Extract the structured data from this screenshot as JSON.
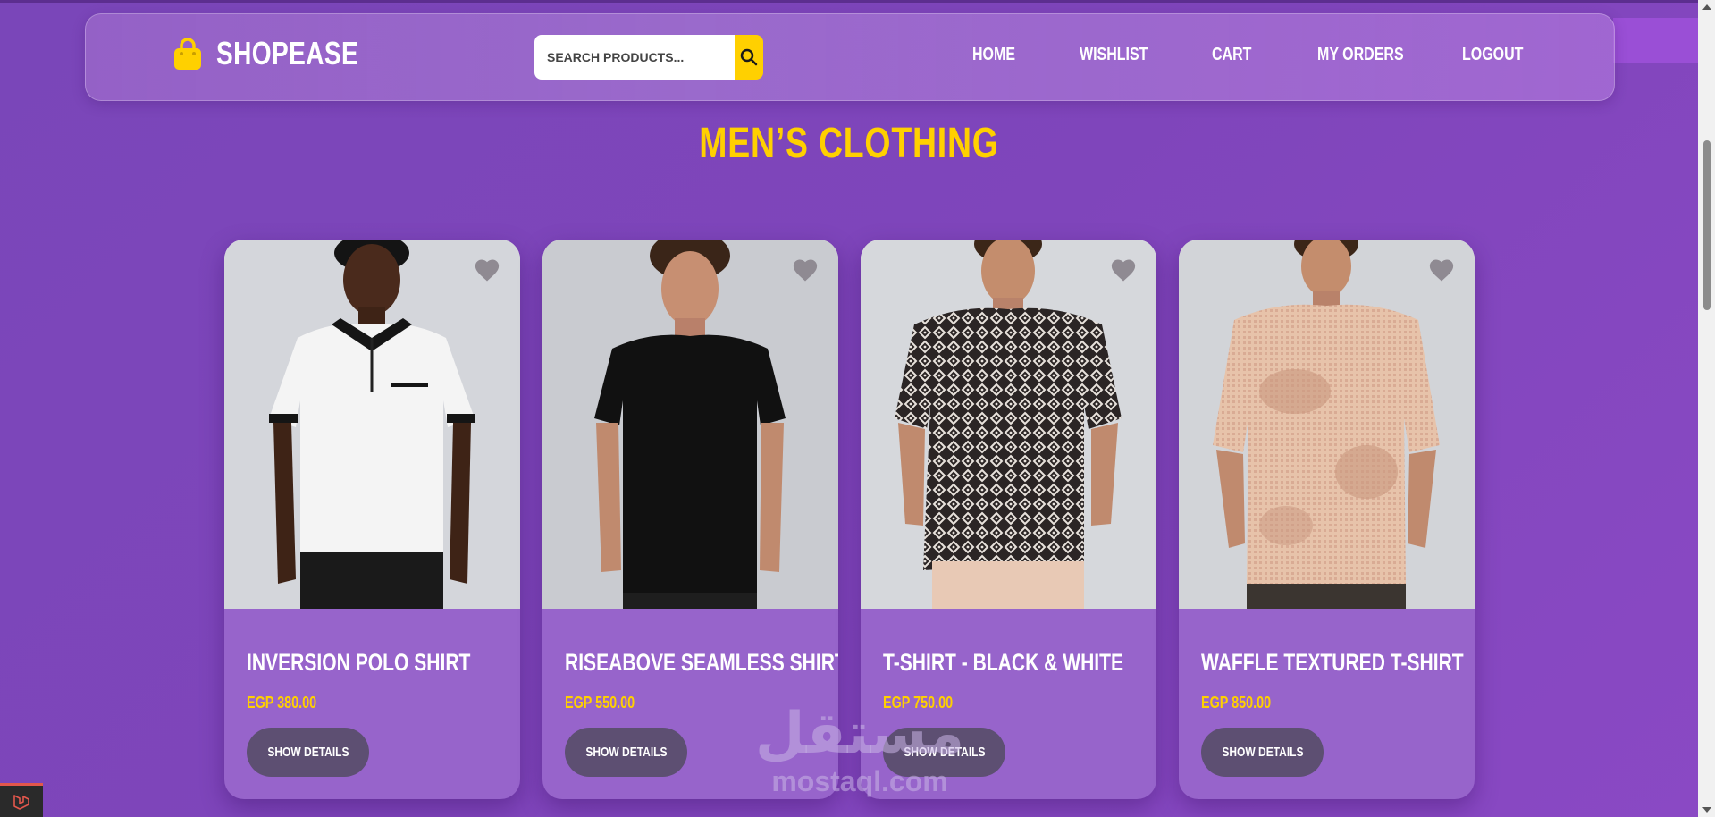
{
  "brand": {
    "name": "SHOPEASE",
    "icon": "shopping-bag-icon",
    "icon_color": "#ffd000"
  },
  "search": {
    "placeholder": "SEARCH PRODUCTS...",
    "value": "",
    "icon": "search-icon",
    "button_color": "#ffd000"
  },
  "nav": {
    "home": "HOME",
    "wishlist": "WISHLIST",
    "cart": "CART",
    "my_orders": "MY ORDERS",
    "logout": "LOGOUT"
  },
  "section": {
    "title": "MEN’S CLOTHING"
  },
  "products": [
    {
      "name": "INVERSION POLO SHIRT",
      "price": "EGP 380.00",
      "button": "SHOW DETAILS",
      "wishlist_icon": "heart-icon"
    },
    {
      "name": "RISEABOVE SEAMLESS SHIRT",
      "price": "EGP 550.00",
      "button": "SHOW DETAILS",
      "wishlist_icon": "heart-icon"
    },
    {
      "name": "T-SHIRT - BLACK & WHITE",
      "price": "EGP 750.00",
      "button": "SHOW DETAILS",
      "wishlist_icon": "heart-icon"
    },
    {
      "name": "WAFFLE TEXTURED T-SHIRT",
      "price": "EGP 850.00",
      "button": "SHOW DETAILS",
      "wishlist_icon": "heart-icon"
    }
  ],
  "watermark": {
    "arabic": "مستقل",
    "latin": "mostaql.com"
  },
  "colors": {
    "accent": "#ffd000",
    "background": "#7f45bb",
    "card": "#9764cb",
    "button": "#5d4f72"
  }
}
